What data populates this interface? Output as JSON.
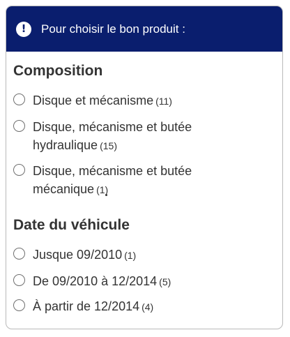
{
  "header": {
    "title": "Pour choisir le bon produit :",
    "icon": "exclamation-icon",
    "icon_glyph": "!"
  },
  "sections": [
    {
      "title": "Composition",
      "options": [
        {
          "label": "Disque et mécanisme",
          "count": "(11)"
        },
        {
          "label": "Disque, mécanisme et butée hydraulique",
          "count": "(15)"
        },
        {
          "label": "Disque, mécanisme et butée mécanique",
          "count": "(1)"
        }
      ]
    },
    {
      "title": "Date du véhicule",
      "options": [
        {
          "label": "Jusque 09/2010",
          "count": "(1)"
        },
        {
          "label": "De 09/2010 à 12/2014",
          "count": "(5)"
        },
        {
          "label": "À partir de 12/2014",
          "count": "(4)"
        }
      ]
    }
  ],
  "colors": {
    "header_bg": "#0a1e6e",
    "header_text": "#ffffff",
    "text": "#333333",
    "border": "#b9b9b9"
  }
}
